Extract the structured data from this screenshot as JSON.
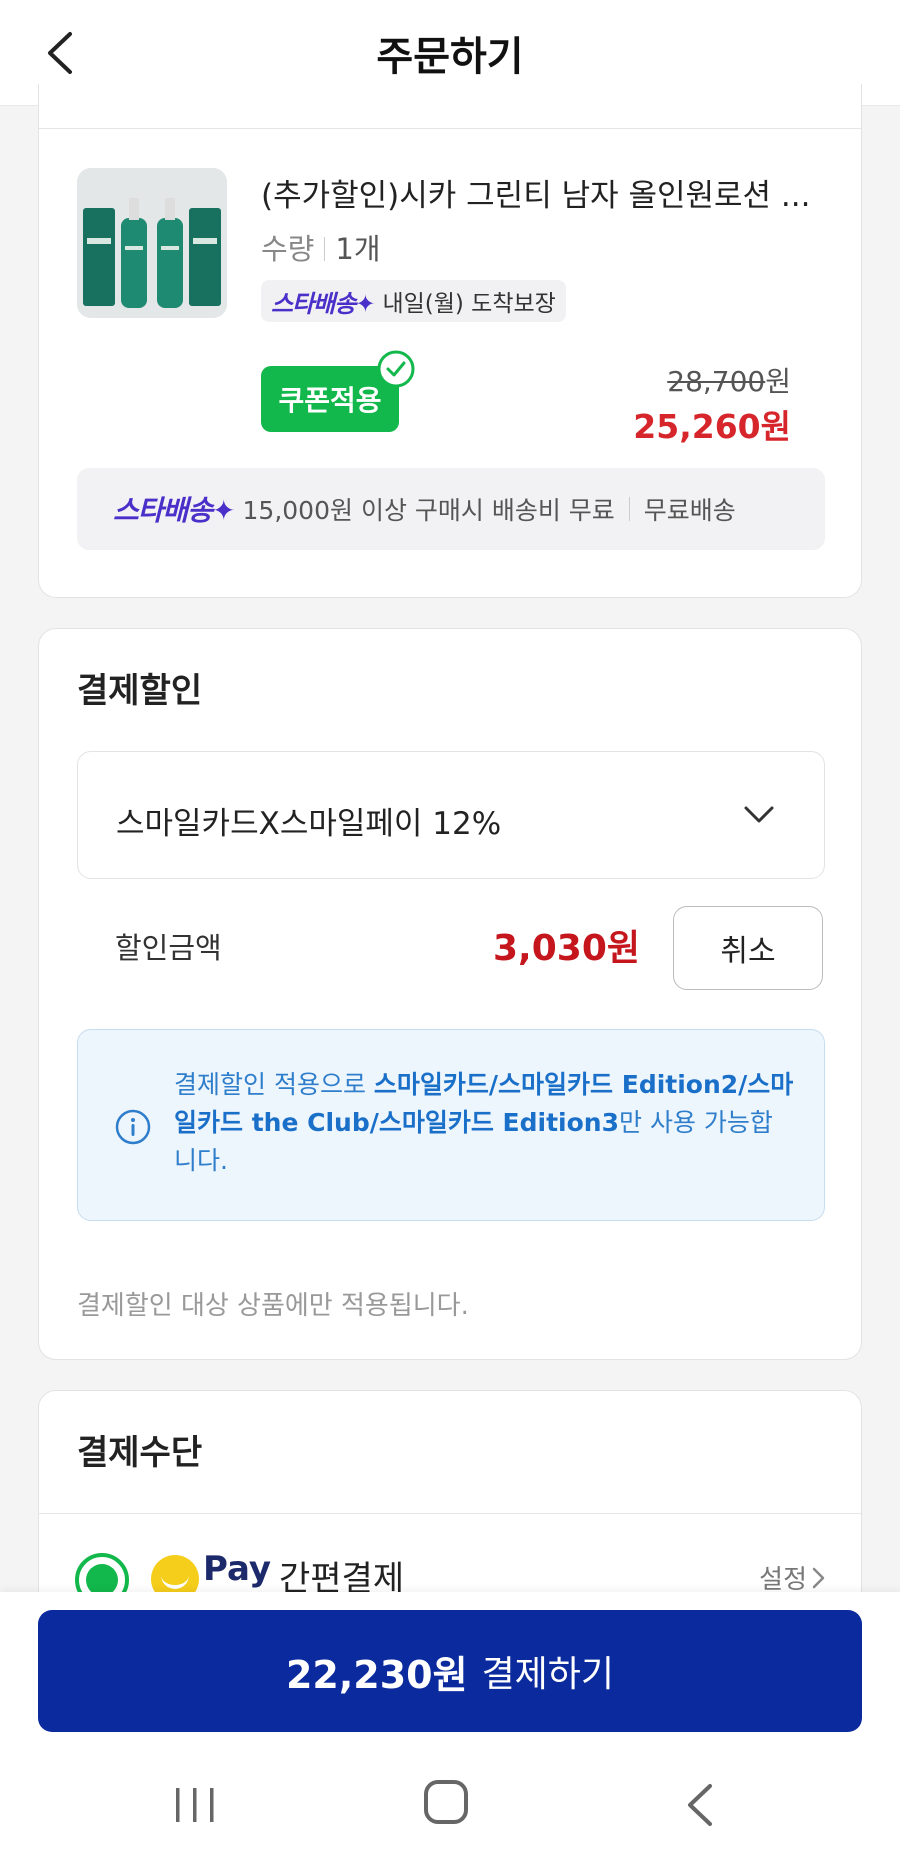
{
  "header": {
    "title": "주문하기"
  },
  "product": {
    "name": "(추가할인)시카 그린티 남자 올인원로션 ...",
    "qty_label": "수량",
    "qty_value": "1개",
    "star_logo": "스타배송✦",
    "delivery_text": "내일(월) 도착보장",
    "coupon_label": "쿠폰적용",
    "orig_price": "28,700",
    "orig_unit": "원",
    "sale_price": "25,260원",
    "shipping_logo": "스타배송✦",
    "shipping_text": "15,000원 이상 구매시 배송비 무료",
    "shipping_free": "무료배송"
  },
  "discount": {
    "title": "결제할인",
    "selected_option": "스마일카드X스마일페이 12%",
    "amount_label": "할인금액",
    "amount_value": "3,030원",
    "cancel_label": "취소",
    "info_prefix": "결제할인 적용으로 ",
    "info_bold": "스마일카드/스마일카드 Edition2/스마일카드 the Club/스마일카드 Edition3",
    "info_suffix": "만 사용 가능합니다.",
    "note": "결제할인 대상 상품에만 적용됩니다."
  },
  "payment": {
    "title": "결제수단",
    "pay_word": "Pay",
    "pay_label": "간편결제",
    "setting_label": "설정"
  },
  "bottom": {
    "amount": "22,230원",
    "action": "결제하기"
  },
  "colors": {
    "accent_green": "#12b84b",
    "price_red": "#d6262b",
    "pay_button": "#0a2a9e",
    "info_blue": "#2f7ecb"
  }
}
